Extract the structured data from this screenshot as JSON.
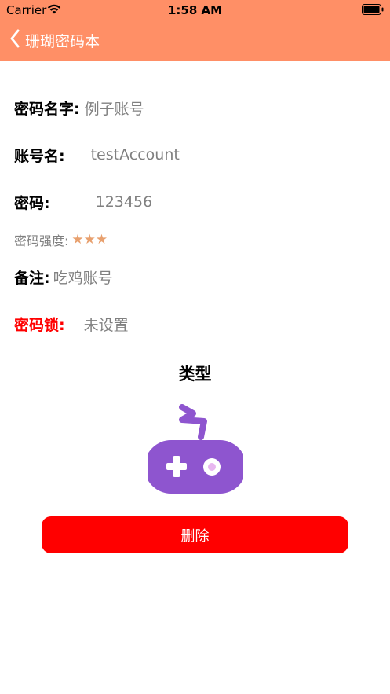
{
  "status_bar": {
    "carrier": "Carrier",
    "time": "1:58 AM"
  },
  "nav": {
    "back_title": "珊瑚密码本"
  },
  "fields": {
    "name_label": "密码名字:",
    "name_value": "例子账号",
    "account_label": "账号名:",
    "account_value": "testAccount",
    "password_label": "密码:",
    "password_value": "123456",
    "strength_label": "密码强度:",
    "strength_stars": 3,
    "note_label": "备注:",
    "note_value": "吃鸡账号",
    "lock_label": "密码锁:",
    "lock_value": "未设置"
  },
  "type": {
    "title": "类型",
    "icon": "gamepad-icon",
    "icon_color": "#8E55CF"
  },
  "actions": {
    "delete_label": "删除"
  },
  "colors": {
    "nav_bar": "#FF8F66",
    "delete_button": "#FF0000",
    "lock_label": "#FF0000",
    "star": "#E8A06E"
  }
}
